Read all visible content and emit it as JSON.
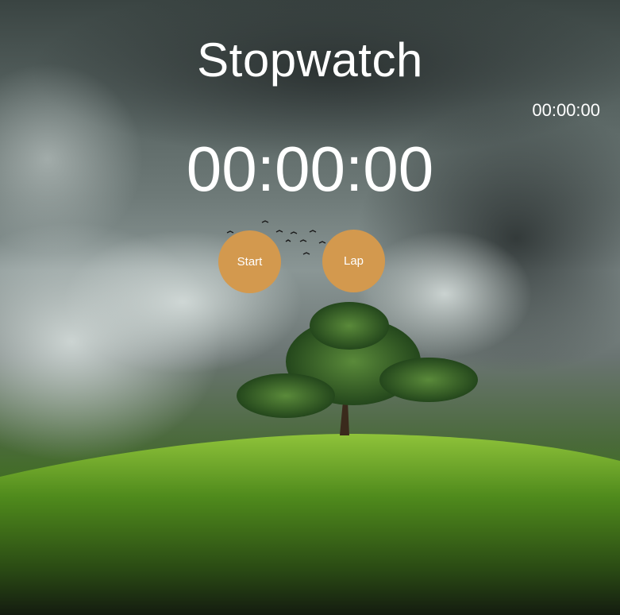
{
  "app": {
    "title": "Stopwatch"
  },
  "timer": {
    "display": "00:00:00",
    "lap_display": "00:00:00"
  },
  "controls": {
    "start_label": "Start",
    "lap_label": "Lap"
  },
  "colors": {
    "button": "#d3994e",
    "text": "#ffffff"
  }
}
